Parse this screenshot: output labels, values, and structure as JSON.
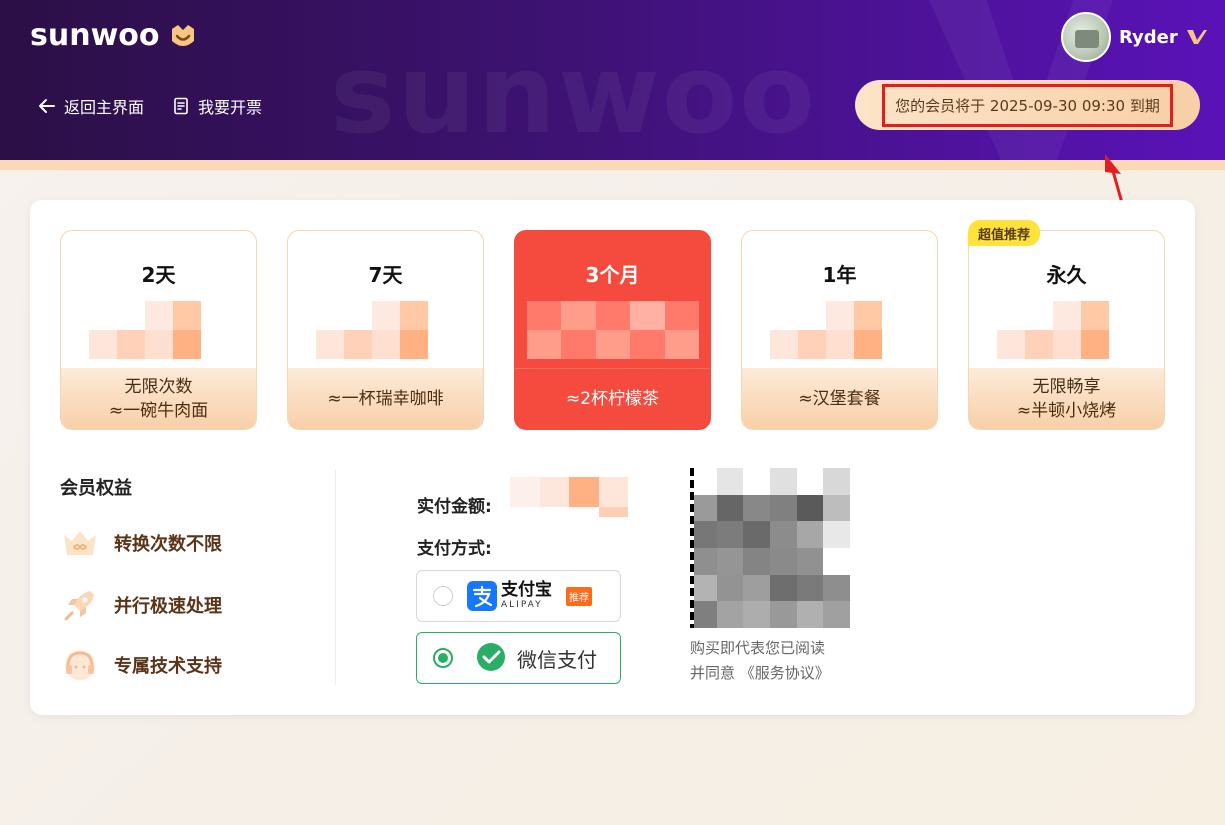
{
  "header": {
    "logo_text": "sunwoo",
    "watermark": "sunwoo",
    "nav": {
      "back_label": "返回主界面",
      "invoice_label": "我要开票"
    },
    "user": {
      "name": "Ryder"
    },
    "expire_notice": "您的会员将于 2025-09-30 09:30 到期"
  },
  "plans": [
    {
      "name": "2天",
      "desc_line1": "无限次数",
      "desc_line2": "≈一碗牛肉面",
      "selected": false
    },
    {
      "name": "7天",
      "desc_line1": "≈一杯瑞幸咖啡",
      "desc_line2": "",
      "selected": false
    },
    {
      "name": "3个月",
      "desc_line1": "≈2杯柠檬茶",
      "desc_line2": "",
      "selected": true
    },
    {
      "name": "1年",
      "desc_line1": "≈汉堡套餐",
      "desc_line2": "",
      "selected": false
    },
    {
      "name": "永久",
      "desc_line1": "无限畅享",
      "desc_line2": "≈半顿小烧烤",
      "selected": false,
      "badge": "超值推荐"
    }
  ],
  "benefits": {
    "title": "会员权益",
    "items": [
      {
        "label": "转换次数不限",
        "icon": "crown-infinity-icon"
      },
      {
        "label": "并行极速处理",
        "icon": "rocket-icon"
      },
      {
        "label": "专属技术支持",
        "icon": "headset-icon"
      }
    ]
  },
  "payment": {
    "amount_label": "实付金额:",
    "method_label": "支付方式:",
    "alipay": {
      "name_cn": "支付宝",
      "name_en": "ALIPAY",
      "tag": "推荐",
      "selected": false
    },
    "wechat": {
      "name": "微信支付",
      "selected": true
    }
  },
  "agreement": {
    "line1": "购买即代表您已阅读",
    "line2_prefix": "并同意 ",
    "link": "《服务协议》"
  },
  "colors": {
    "header_start": "#2b0f45",
    "header_end": "#5a12b8",
    "accent_red": "#f54b3f",
    "wechat_green": "#2aae67",
    "alipay_blue": "#1677ff"
  }
}
